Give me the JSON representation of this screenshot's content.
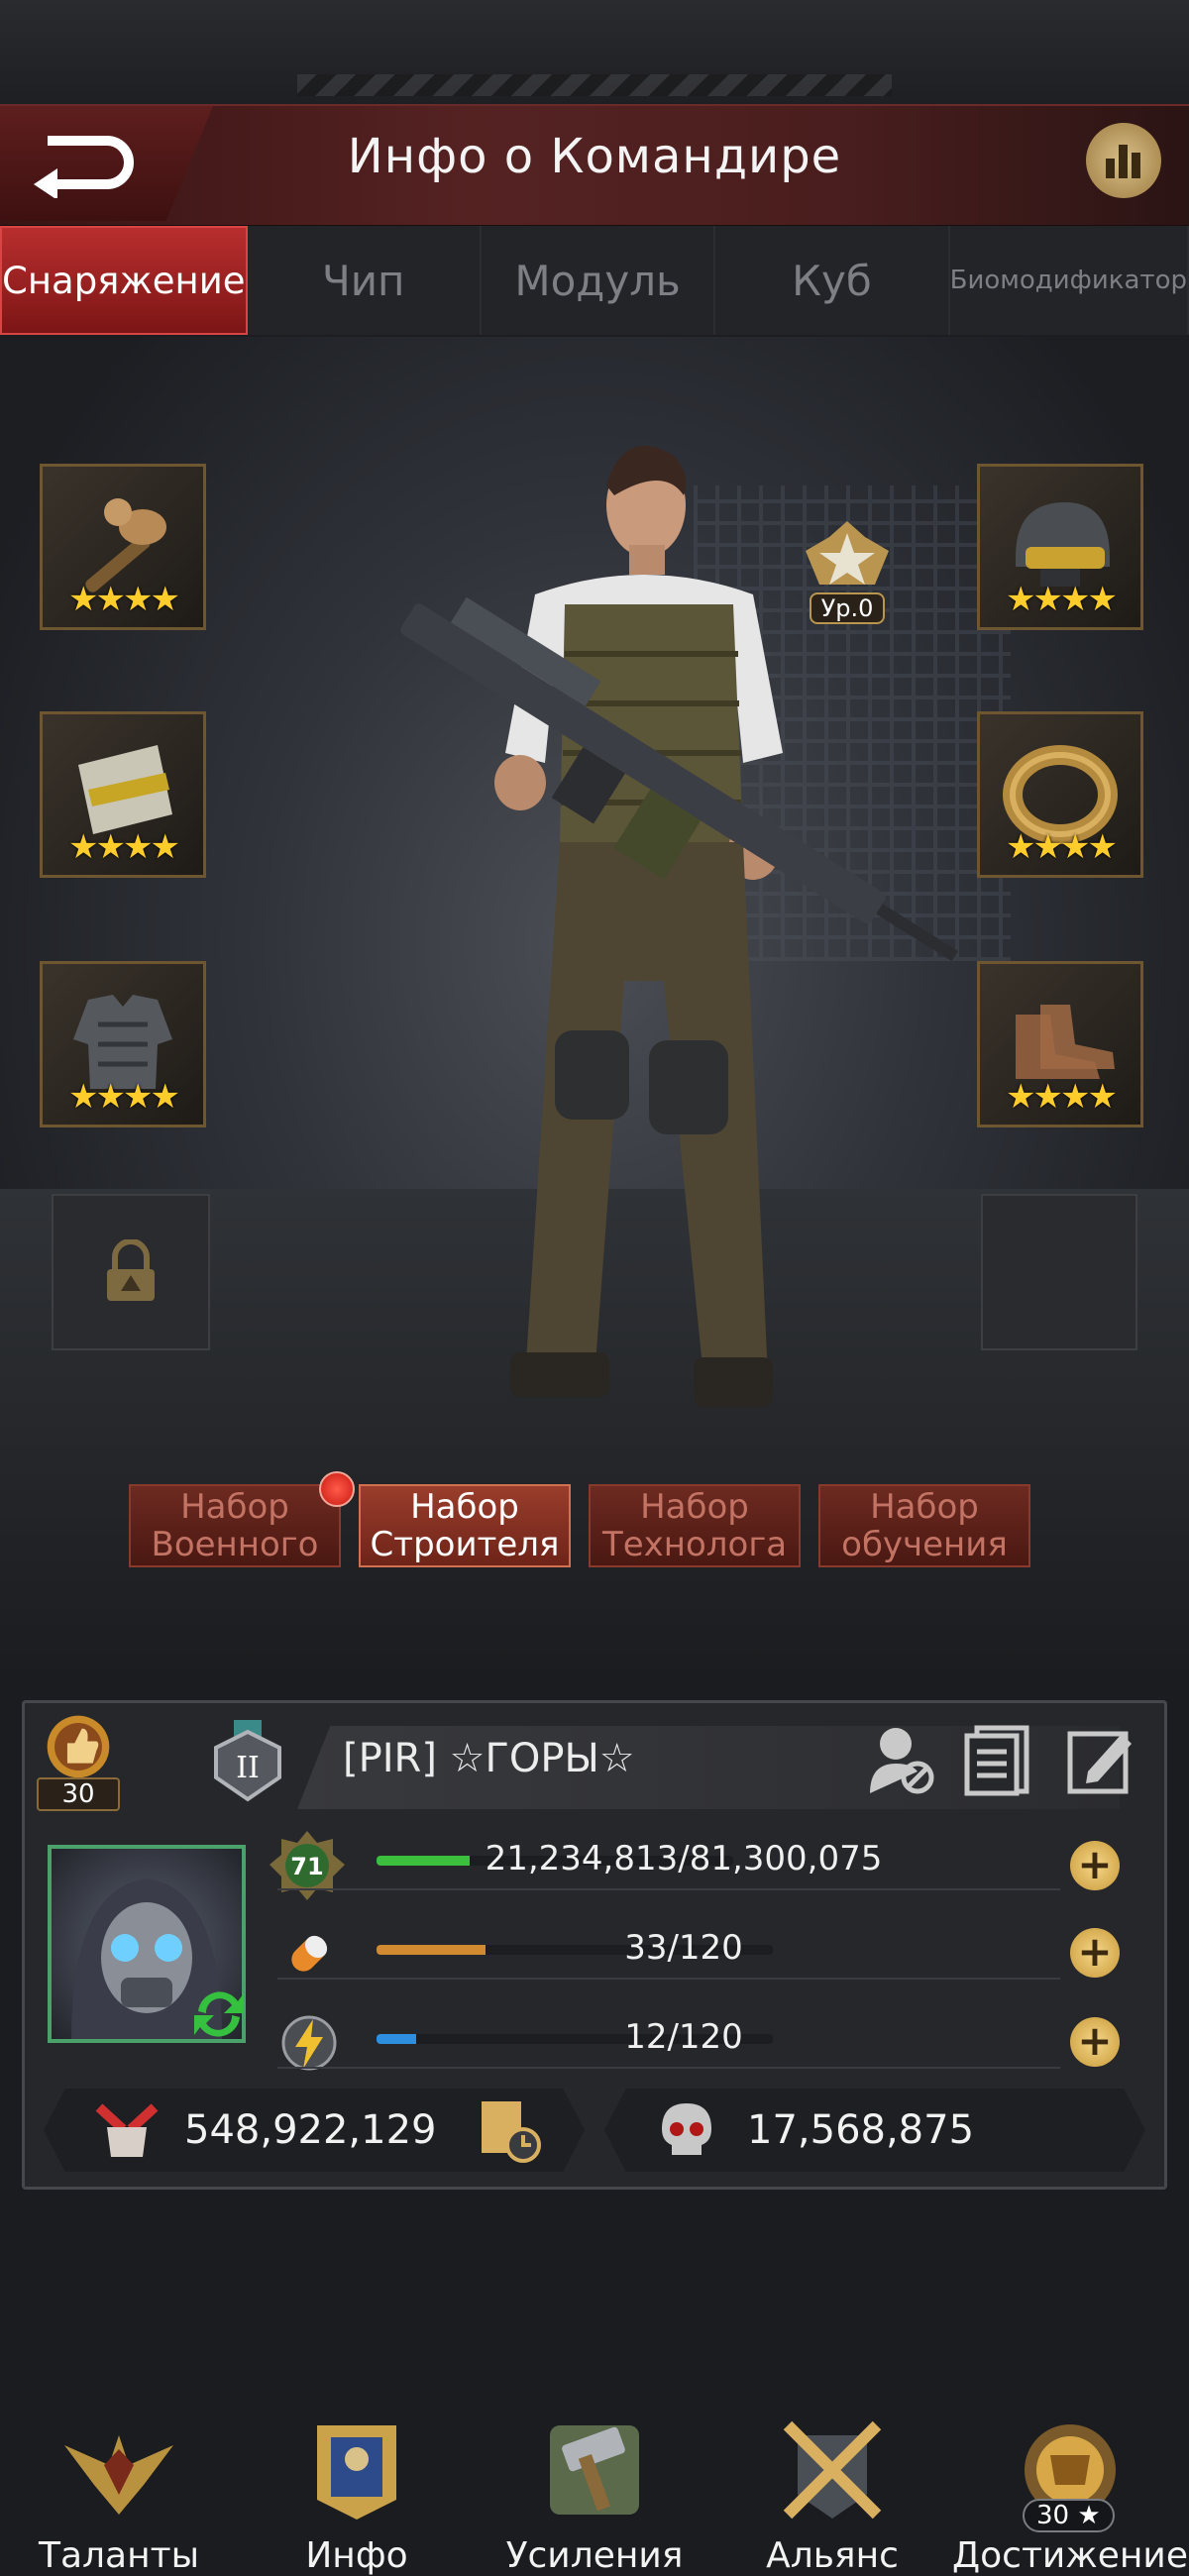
{
  "header": {
    "title": "Инфо о Командире",
    "back_icon": "back-arrow-icon",
    "stats_icon": "bar-chart-icon"
  },
  "tabs": [
    {
      "label": "Снаряжение",
      "active": true
    },
    {
      "label": "Чип",
      "active": false
    },
    {
      "label": "Модуль",
      "active": false
    },
    {
      "label": "Куб",
      "active": false
    },
    {
      "label": "Биомодификатор",
      "active": false
    }
  ],
  "equipment": {
    "rank_label": "Ур.0",
    "left_slots": [
      {
        "name": "weapon-attachment",
        "stars": "★★★★"
      },
      {
        "name": "shield-plate",
        "stars": "★★★★"
      },
      {
        "name": "body-armor",
        "stars": "★★★★"
      }
    ],
    "right_slots": [
      {
        "name": "helmet",
        "stars": "★★★★"
      },
      {
        "name": "ring",
        "stars": "★★★★"
      },
      {
        "name": "boots",
        "stars": "★★★★"
      }
    ]
  },
  "sets": [
    {
      "line1": "Набор",
      "line2": "Военного",
      "active": false,
      "notification": true
    },
    {
      "line1": "Набор",
      "line2": "Строителя",
      "active": true,
      "notification": false
    },
    {
      "line1": "Набор",
      "line2": "Технолога",
      "active": false,
      "notification": false
    },
    {
      "line1": "Набор",
      "line2": "обучения",
      "active": false,
      "notification": false
    }
  ],
  "profile": {
    "vip_level": "30",
    "rank_roman": "II",
    "name": "[PIR]  ☆ГОРЫ☆",
    "commander_level": "71",
    "exp": {
      "text": "21,234,813/81,300,075",
      "fraction": 0.26
    },
    "stamina": {
      "text": "33/120",
      "fraction": 0.275
    },
    "energy": {
      "text": "12/120",
      "fraction": 0.1
    },
    "power": "548,922,129",
    "kills": "17,568,875"
  },
  "colors": {
    "exp_bar": "#3cbf3c",
    "stamina_bar": "#d18a30",
    "energy_bar": "#2e8fe0",
    "active_tab": "#b92e2e",
    "stars": "#ffcd2b"
  },
  "nav": [
    {
      "label": "Таланты",
      "icon": "eagle-emblem-icon"
    },
    {
      "label": "Инфо",
      "icon": "commander-info-icon"
    },
    {
      "label": "Усиления",
      "icon": "hammer-icon"
    },
    {
      "label": "Альянс",
      "icon": "crossed-swords-icon"
    },
    {
      "label": "Достижение",
      "icon": "lion-trophy-icon",
      "badge": "30 ★"
    }
  ]
}
